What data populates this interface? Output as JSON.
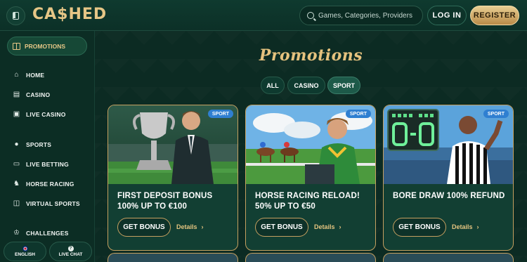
{
  "header": {
    "logo": "CA$HED",
    "search_placeholder": "Games, Categories, Providers",
    "login_label": "LOG IN",
    "register_label": "REGISTER"
  },
  "sidebar": {
    "promotions_label": "PROMOTIONS",
    "items": [
      {
        "label": "HOME",
        "icon": "home-icon"
      },
      {
        "label": "CASINO",
        "icon": "slot-machine-icon"
      },
      {
        "label": "LIVE CASINO",
        "icon": "cards-icon"
      },
      {
        "label": "SPORTS",
        "icon": "ball-icon"
      },
      {
        "label": "LIVE BETTING",
        "icon": "live-icon"
      },
      {
        "label": "HORSE RACING",
        "icon": "horse-icon"
      },
      {
        "label": "VIRTUAL SPORTS",
        "icon": "virtual-icon"
      },
      {
        "label": "CHALLENGES",
        "icon": "trophy-icon"
      }
    ],
    "language_label": "ENGLISH",
    "chat_label": "LIVE CHAT"
  },
  "main": {
    "title": "Promotions",
    "filters": [
      {
        "label": "ALL",
        "active": false
      },
      {
        "label": "CASINO",
        "active": false
      },
      {
        "label": "SPORT",
        "active": true
      }
    ],
    "cards": [
      {
        "badge": "SPORT",
        "title_line1": "FIRST DEPOSIT BONUS",
        "title_line2": "100% UP TO €100",
        "button": "GET BONUS",
        "details": "Details"
      },
      {
        "badge": "SPORT",
        "title_line1": "HORSE RACING RELOAD!",
        "title_line2": "50% UP TO €50",
        "button": "GET BONUS",
        "details": "Details"
      },
      {
        "badge": "SPORT",
        "title_line1": "BORE DRAW 100% REFUND",
        "title_line2": "",
        "button": "GET BONUS",
        "details": "Details"
      }
    ]
  },
  "colors": {
    "gold": "#e6c686",
    "background": "#0b2a22",
    "badge_blue": "#2f7fd1"
  }
}
